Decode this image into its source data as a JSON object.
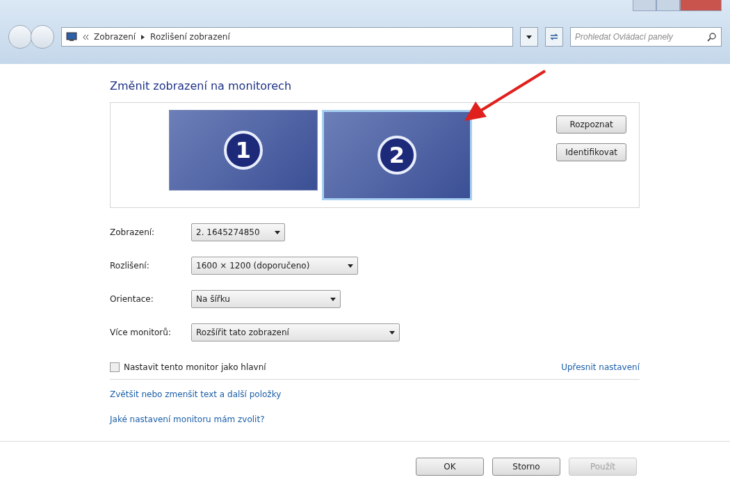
{
  "address_bar": {
    "breadcrumbs": [
      "Zobrazení",
      "Rozlišení zobrazení"
    ],
    "search": {
      "placeholder": "Prohledat Ovládací panely"
    }
  },
  "heading": "Změnit zobrazení na monitorech",
  "monitors": [
    {
      "number": "1",
      "selected": false
    },
    {
      "number": "2",
      "selected": true
    }
  ],
  "monitor_buttons": [
    "Rozpoznat",
    "Identifikovat"
  ],
  "settings": [
    {
      "label": "Zobrazení:",
      "value": "2. 1645274850"
    },
    {
      "label": "Rozlišení:",
      "value": "1600 × 1200 (doporučeno)"
    },
    {
      "label": "Orientace:",
      "value": "Na šířku"
    },
    {
      "label": "Více monitorů:",
      "value": "Rozšířit tato zobrazení"
    }
  ],
  "main_monitor_checkbox": {
    "label": "Nastavit tento monitor jako hlavní",
    "checked": false
  },
  "advanced_link": "Upřesnit nastavení",
  "links": [
    "Zvětšit nebo zmenšit text a další položky",
    "Jaké nastavení monitoru mám zvolit?"
  ],
  "buttons": [
    {
      "label": "OK",
      "disabled": false
    },
    {
      "label": "Storno",
      "disabled": false
    },
    {
      "label": "Použít",
      "disabled": true
    }
  ]
}
